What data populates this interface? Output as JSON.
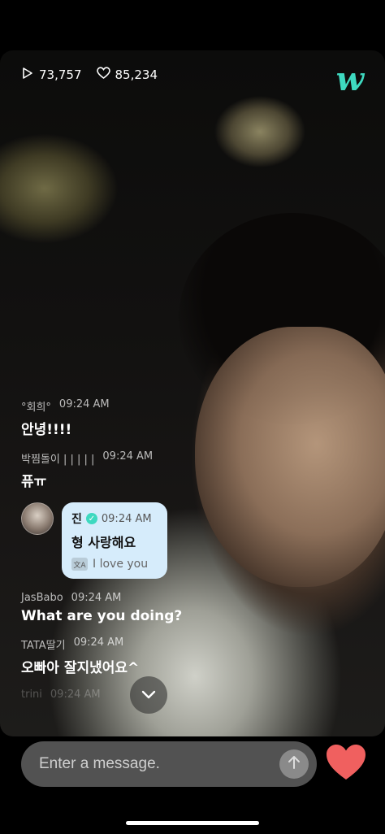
{
  "stats": {
    "views": "73,757",
    "likes": "85,234"
  },
  "logo": "w",
  "chat": [
    {
      "user": "°회희°",
      "time": "09:24 AM",
      "text": "안녕!!!!"
    },
    {
      "user": "박찜돌이 | | | | |",
      "time": "09:24 AM",
      "text": "퓨ㅠ"
    },
    {
      "artist": true,
      "user": "진",
      "time": "09:24 AM",
      "text": "형 사랑해요",
      "translation": "I love you"
    },
    {
      "user": "JasBabo",
      "time": "09:24 AM",
      "text": "What are you doing?"
    },
    {
      "user": "TATA딸기",
      "time": "09:24 AM",
      "text": "오빠아 잘지냈어요^"
    },
    {
      "user": "trini",
      "time": "09:24 AM"
    }
  ],
  "input": {
    "placeholder": "Enter a message."
  },
  "colors": {
    "accent": "#3ed9c0",
    "heart": "#f0605f",
    "bubble": "#d6ecfb"
  }
}
